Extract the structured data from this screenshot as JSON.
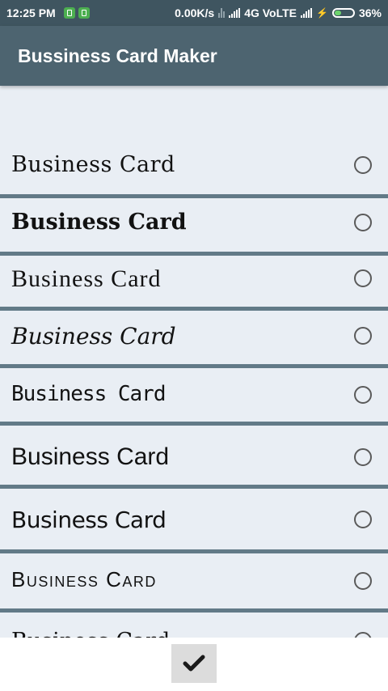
{
  "status_bar": {
    "time": "12:25 PM",
    "speed": "0.00K/s",
    "network": "4G VoLTE",
    "battery": "36%",
    "battery_level": 0.36
  },
  "app": {
    "title": "Bussiness Card Maker"
  },
  "fonts_list": {
    "items": [
      {
        "label": "Business Card",
        "selected": false
      },
      {
        "label": "Business Card",
        "selected": false
      },
      {
        "label": "Business Card",
        "selected": false
      },
      {
        "label": "Business Card",
        "selected": false
      },
      {
        "label": "Business Card",
        "selected": false
      },
      {
        "label": "Business Card",
        "selected": false
      },
      {
        "label": "Business Card",
        "selected": false
      },
      {
        "label": "Business Card",
        "selected": false
      },
      {
        "label": "Business Card",
        "selected": false
      }
    ]
  },
  "bottom": {
    "confirm_icon": "checkmark-icon"
  },
  "colors": {
    "status_bar": "#3f5560",
    "app_bar": "#4d6470",
    "list_bg": "#e9eef4",
    "separator": "#627a87"
  }
}
